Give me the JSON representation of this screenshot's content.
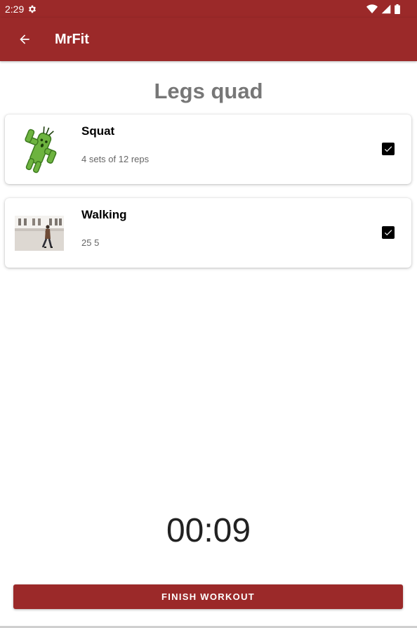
{
  "status_bar": {
    "time": "2:29"
  },
  "app_bar": {
    "title": "MrFit"
  },
  "page": {
    "title": "Legs quad"
  },
  "exercises": [
    {
      "name": "Squat",
      "detail": "4 sets of 12 reps",
      "checked": true,
      "thumb_icon": "cactus-icon"
    },
    {
      "name": "Walking",
      "detail": "25 5",
      "checked": true,
      "thumb_icon": "walking-photo"
    }
  ],
  "timer": {
    "value": "00:09"
  },
  "actions": {
    "finish_label": "FINISH WORKOUT"
  },
  "colors": {
    "primary": "#9b2929",
    "title_gray": "#777777"
  }
}
